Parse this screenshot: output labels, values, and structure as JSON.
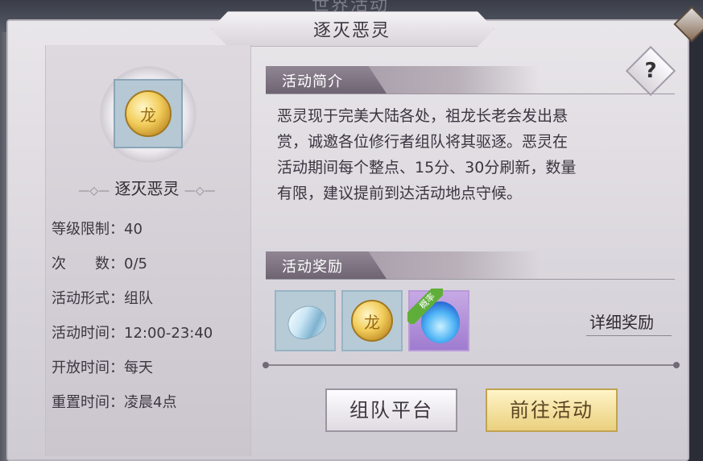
{
  "window": {
    "ghost_title": "世界活动",
    "title": "逐灭恶灵"
  },
  "left": {
    "name": "逐灭恶灵",
    "info": [
      {
        "label": "等级限制：",
        "value": "40"
      },
      {
        "label": "次　　数：",
        "value": "0/5"
      },
      {
        "label": "活动形式：",
        "value": "组队"
      },
      {
        "label": "活动时间：",
        "value": "12:00-23:40"
      },
      {
        "label": "开放时间：",
        "value": "每天"
      },
      {
        "label": "重置时间：",
        "value": "凌晨4点"
      }
    ]
  },
  "intro": {
    "header": "活动简介",
    "help": "?",
    "lines": [
      "恶灵现于完美大陆各处，祖龙长老会发出悬",
      "赏，诚邀各位修行者组队将其驱逐。恶灵在",
      "活动期间每个整点、15分、30分刷新，数量",
      "有限，建议提前到达活动地点守候。"
    ]
  },
  "rewards": {
    "header": "活动奖励",
    "items": [
      {
        "icon": "silver-gem-icon"
      },
      {
        "icon": "gold-coin-icon"
      },
      {
        "icon": "blue-flame-icon",
        "badge": "概率"
      }
    ],
    "detail_link": "详细奖励"
  },
  "buttons": {
    "team": "组队平台",
    "go": "前往活动"
  },
  "colors": {
    "gold_button": "#ead07e",
    "ribbon": "#5fae3a",
    "section_tab": "#7a707e"
  }
}
